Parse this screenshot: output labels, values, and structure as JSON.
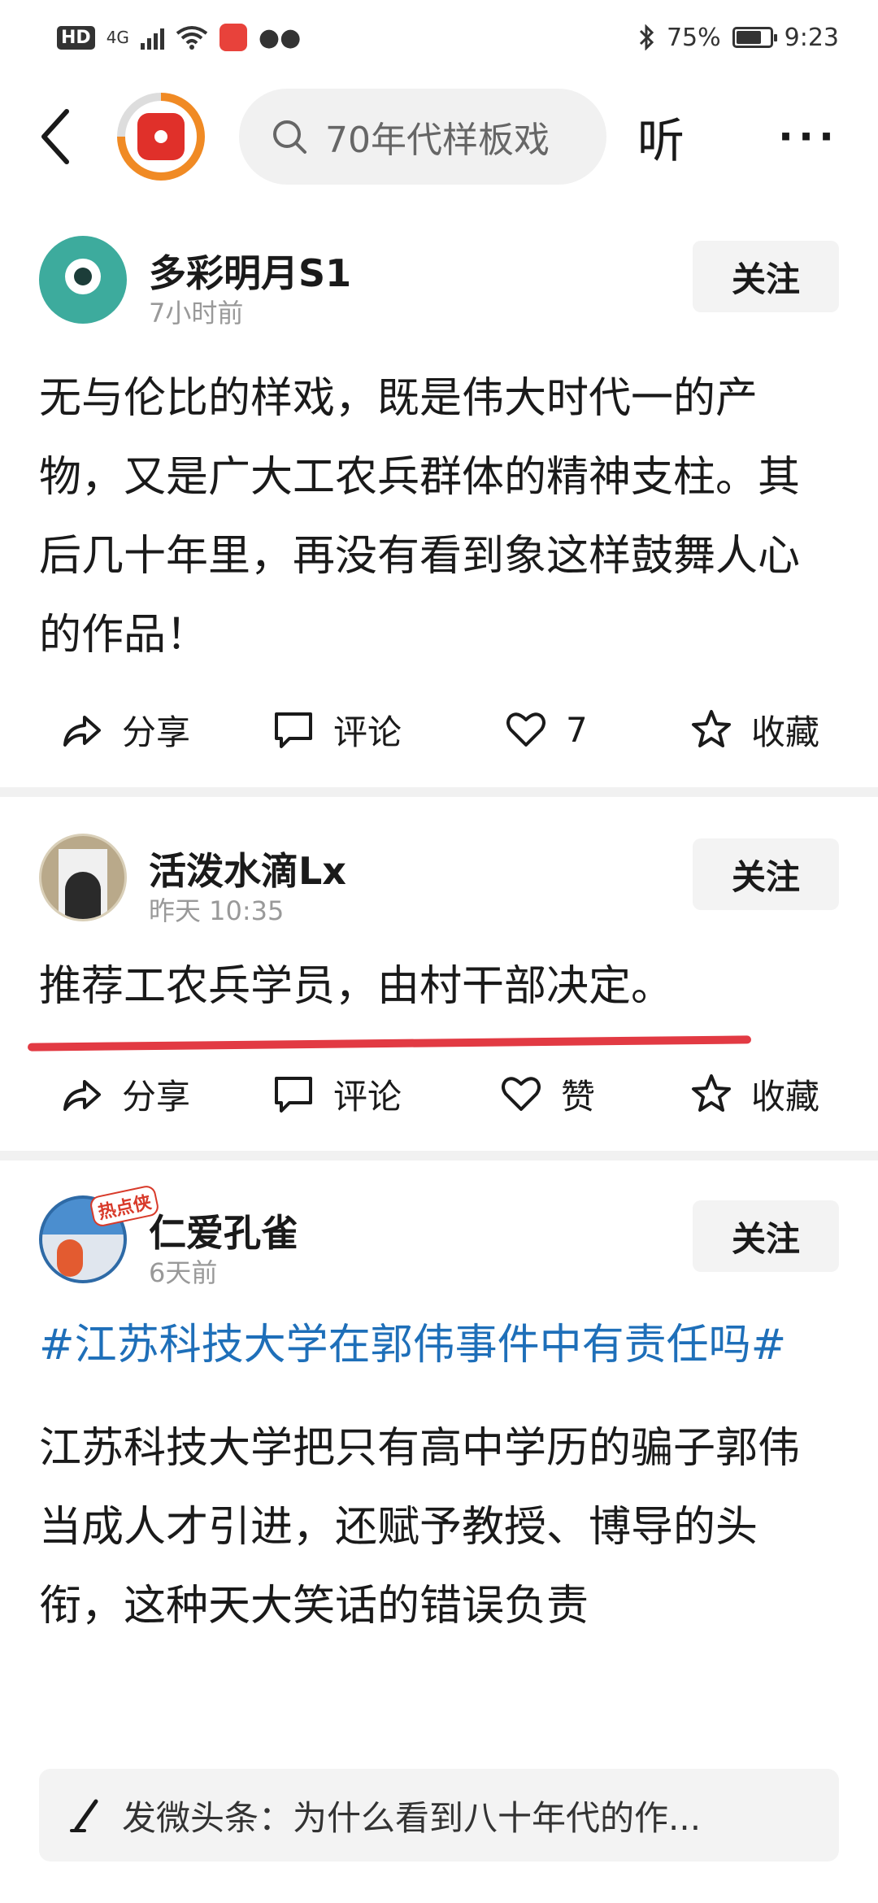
{
  "status_bar": {
    "hd": "HD",
    "network": "4G",
    "battery_percent": "75%",
    "battery_level": 0.75,
    "time": "9:23"
  },
  "top_nav": {
    "search_text": "70年代样板戏",
    "listen_label": "听",
    "more_label": "···"
  },
  "posts": [
    {
      "user": "多彩明月S1",
      "time": "7小时前",
      "follow_label": "关注",
      "text": "无与伦比的样戏，既是伟大时代一的产物，又是广大工农兵群体的精神支柱。其后几十年里，再没有看到象这样鼓舞人心的作品！",
      "share_label": "分享",
      "comment_label": "评论",
      "like_label": "7",
      "favorite_label": "收藏"
    },
    {
      "user": "活泼水滴Lx",
      "time": "昨天  10:35",
      "follow_label": "关注",
      "text": "推荐工农兵学员，由村干部决定。",
      "share_label": "分享",
      "comment_label": "评论",
      "like_label": "赞",
      "favorite_label": "收藏"
    },
    {
      "user": "仁爱孔雀",
      "time": "6天前",
      "badge": "热点侠",
      "follow_label": "关注",
      "topic": "#江苏科技大学在郭伟事件中有责任吗#",
      "text": "江苏科技大学把只有高中学历的骗子郭伟当成人才引进，还赋予教授、博导的头衔，这种天大笑话的错误负责"
    }
  ],
  "comment_bar": {
    "text": "发微头条：为什么看到八十年代的作..."
  },
  "icons": {
    "back": "back-arrow-icon",
    "search": "search-icon",
    "share": "share-icon",
    "comment": "comment-icon",
    "like": "heart-icon",
    "favorite": "star-icon",
    "pen": "pen-icon"
  },
  "colors": {
    "topic_blue": "#1e6fb9",
    "underline_red": "#e23a43",
    "ring_orange": "#f08a24"
  }
}
